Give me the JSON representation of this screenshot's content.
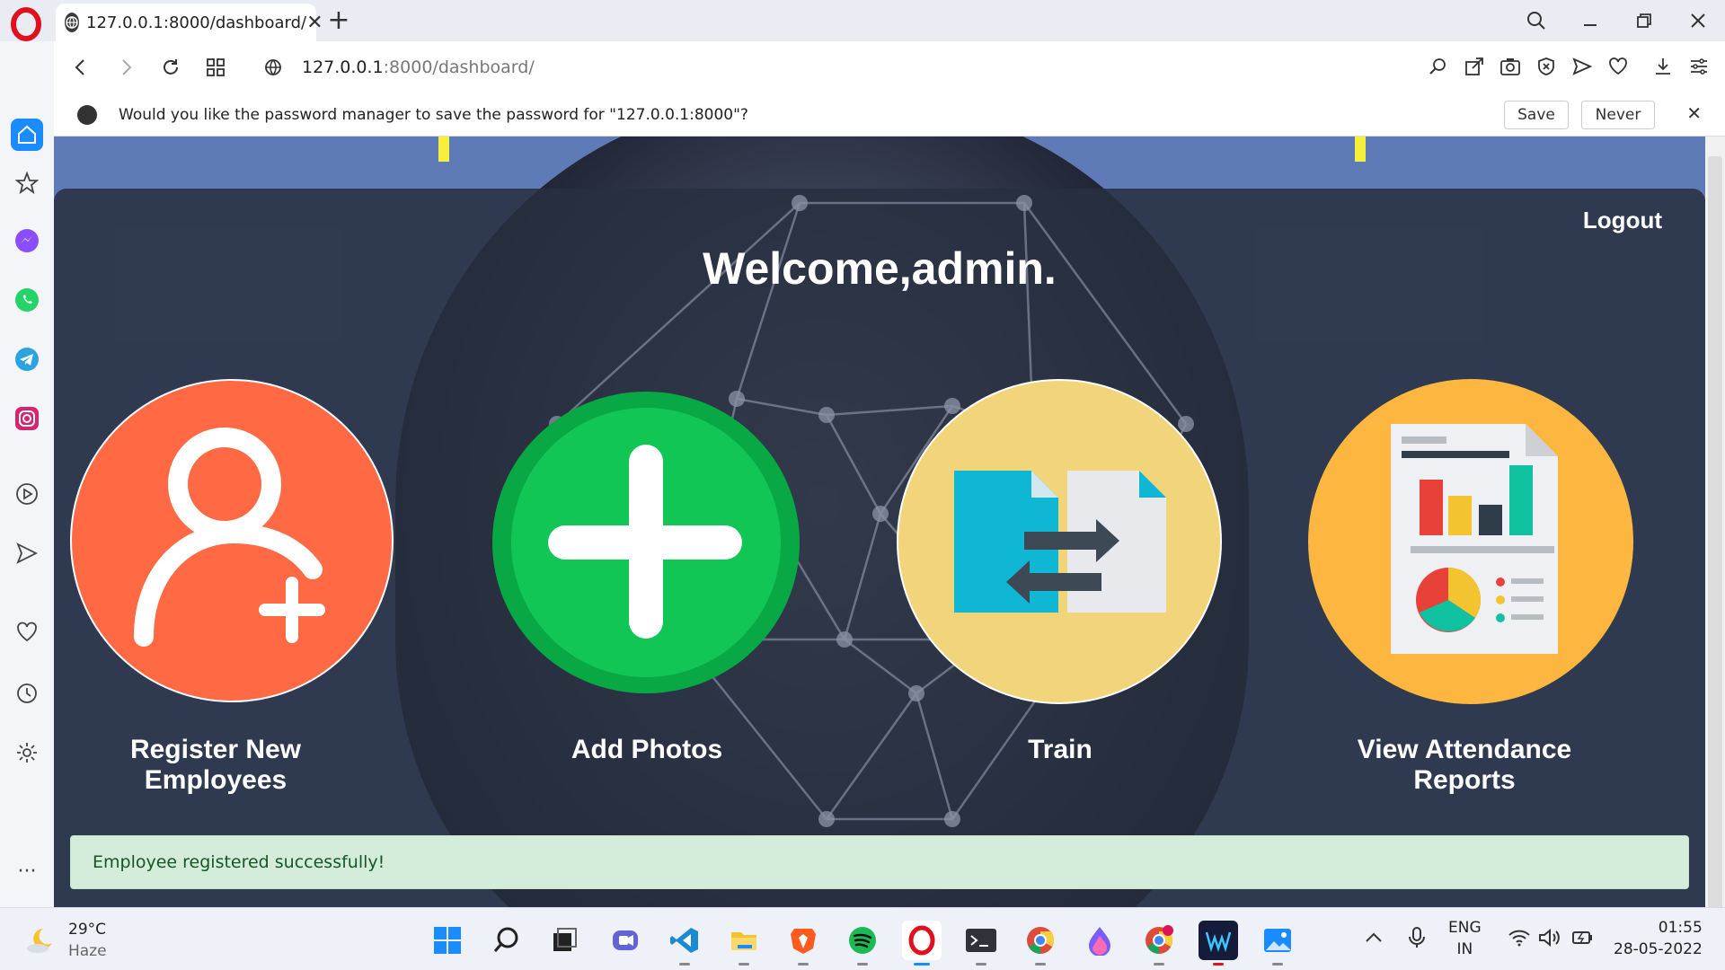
{
  "browser": {
    "tab_title": "127.0.0.1:8000/dashboard/",
    "url_host": "127.0.0.1",
    "url_path": ":8000/dashboard/",
    "password_prompt": "Would you like the password manager to save the password for \"127.0.0.1:8000\"?",
    "save_label": "Save",
    "never_label": "Never"
  },
  "page": {
    "logout_label": "Logout",
    "welcome": "Welcome,admin.",
    "cards": [
      {
        "label_line1": "Register New",
        "label_line2": "Employees",
        "icon": "add-user-icon",
        "color": "#ff6a45"
      },
      {
        "label_line1": "Add Photos",
        "label_line2": "",
        "icon": "plus-icon",
        "color": "#12c656"
      },
      {
        "label_line1": "Train",
        "label_line2": "",
        "icon": "file-transfer-icon",
        "color": "#f2d57b"
      },
      {
        "label_line1": "View Attendance",
        "label_line2": "Reports",
        "icon": "report-icon",
        "color": "#fdb741"
      }
    ],
    "alert": "Employee registered successfully!"
  },
  "taskbar": {
    "temperature": "29°C",
    "weather": "Haze",
    "lang_line1": "ENG",
    "lang_line2": "IN",
    "time": "01:55",
    "date": "28-05-2022"
  }
}
